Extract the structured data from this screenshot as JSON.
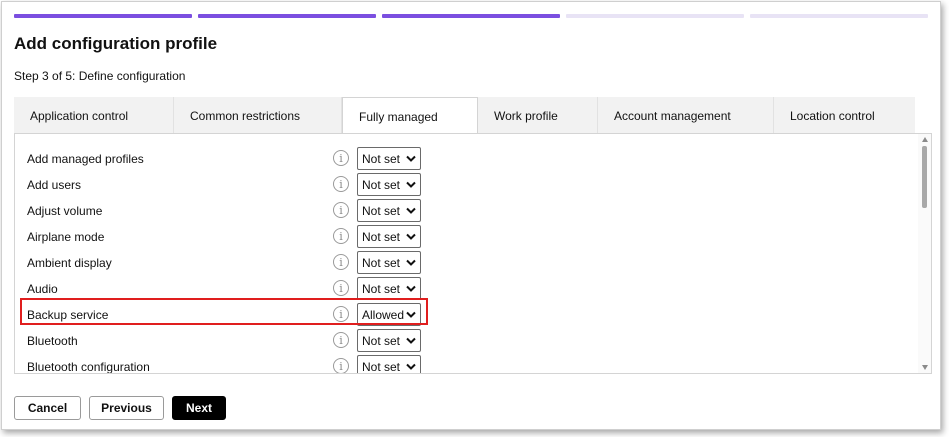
{
  "progress": {
    "steps_total": 5,
    "steps_completed": 3,
    "colors": {
      "done": "#7b4fe0",
      "todo": "#e8e3f5"
    }
  },
  "header": {
    "title": "Add configuration profile",
    "step_text": "Step 3 of 5: Define configuration"
  },
  "tabs": [
    {
      "label": "Application control",
      "active": false
    },
    {
      "label": "Common restrictions",
      "active": false
    },
    {
      "label": "Fully managed",
      "active": true
    },
    {
      "label": "Work profile",
      "active": false
    },
    {
      "label": "Account management",
      "active": false
    },
    {
      "label": "Location control",
      "active": false
    }
  ],
  "settings": [
    {
      "label": "Add managed profiles",
      "value": "Not set",
      "icon": "info-icon"
    },
    {
      "label": "Add users",
      "value": "Not set",
      "icon": "info-icon"
    },
    {
      "label": "Adjust volume",
      "value": "Not set",
      "icon": "info-icon"
    },
    {
      "label": "Airplane mode",
      "value": "Not set",
      "icon": "info-icon"
    },
    {
      "label": "Ambient display",
      "value": "Not set",
      "icon": "info-icon"
    },
    {
      "label": "Audio",
      "value": "Not set",
      "icon": "info-icon"
    },
    {
      "label": "Backup service",
      "value": "Allowed",
      "icon": "info-icon",
      "highlighted": true
    },
    {
      "label": "Bluetooth",
      "value": "Not set",
      "icon": "info-icon"
    },
    {
      "label": "Bluetooth configuration",
      "value": "Not set",
      "icon": "info-icon"
    }
  ],
  "highlight_color": "#e01e1e",
  "footer": {
    "cancel_label": "Cancel",
    "previous_label": "Previous",
    "next_label": "Next"
  }
}
